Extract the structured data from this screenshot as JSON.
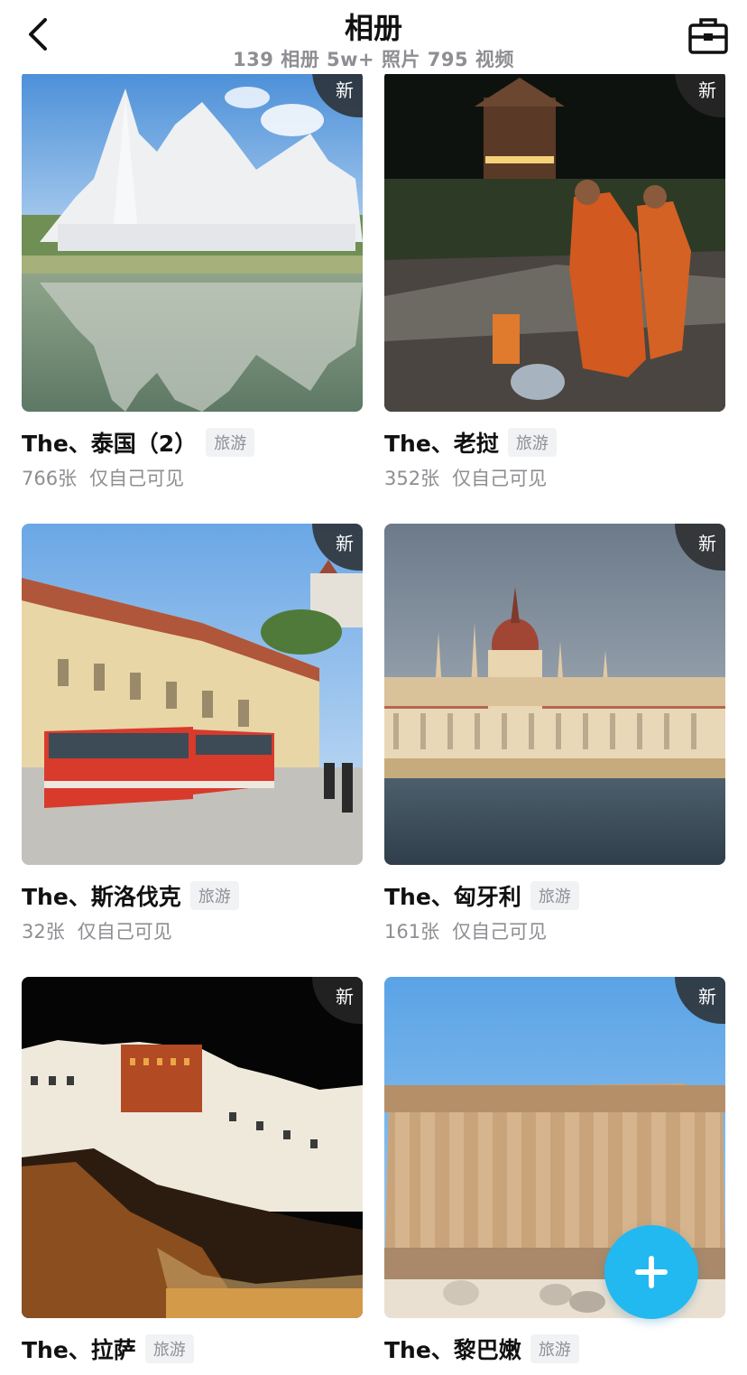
{
  "header": {
    "title": "相册",
    "subtitle": "139 相册 5w+ 照片 795 视频",
    "back_icon": "chevron-left-icon",
    "toolbox_icon": "toolbox-icon"
  },
  "albums": [
    {
      "title": "The、泰国（2）",
      "tag": "旅游",
      "count": "766张",
      "visibility": "仅自己可见",
      "badge": "新"
    },
    {
      "title": "The、老挝",
      "tag": "旅游",
      "count": "352张",
      "visibility": "仅自己可见",
      "badge": "新"
    },
    {
      "title": "The、斯洛伐克",
      "tag": "旅游",
      "count": "32张",
      "visibility": "仅自己可见",
      "badge": "新"
    },
    {
      "title": "The、匈牙利",
      "tag": "旅游",
      "count": "161张",
      "visibility": "仅自己可见",
      "badge": "新"
    },
    {
      "title": "The、拉萨",
      "tag": "旅游",
      "count": "",
      "visibility": "",
      "badge": "新"
    },
    {
      "title": "The、黎巴嫩",
      "tag": "旅游",
      "count": "",
      "visibility": "",
      "badge": "新"
    }
  ],
  "fab": {
    "icon": "plus-icon"
  },
  "colors": {
    "accent": "#21b9f0",
    "badge_bg": "#282828",
    "tag_bg": "#f1f2f4",
    "muted_text": "#8e8e93"
  }
}
